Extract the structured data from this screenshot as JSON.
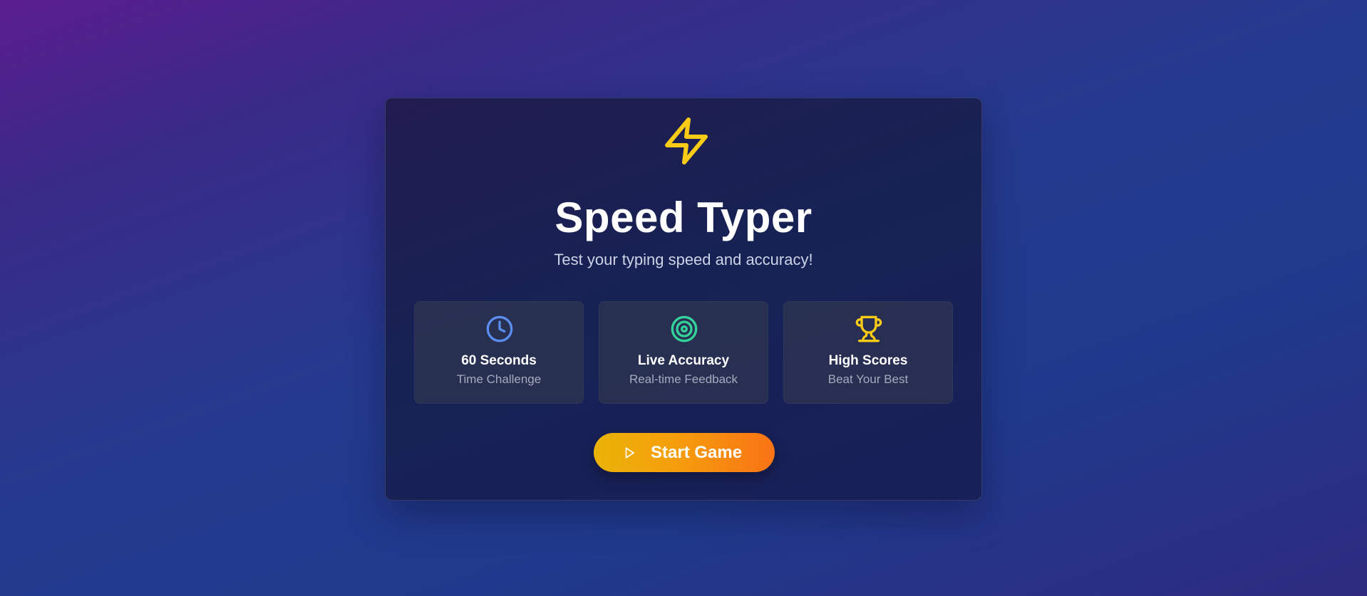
{
  "app": {
    "title": "Speed Typer",
    "subtitle": "Test your typing speed and accuracy!",
    "logo_icon": "lightning-bolt-icon"
  },
  "features": [
    {
      "icon": "clock-icon",
      "icon_color": "#5b8def",
      "title": "60 Seconds",
      "subtitle": "Time Challenge"
    },
    {
      "icon": "target-icon",
      "icon_color": "#34d399",
      "title": "Live Accuracy",
      "subtitle": "Real-time Feedback"
    },
    {
      "icon": "trophy-icon",
      "icon_color": "#facc15",
      "title": "High Scores",
      "subtitle": "Beat Your Best"
    }
  ],
  "start_button": {
    "label": "Start Game",
    "icon": "play-icon"
  },
  "colors": {
    "accent_yellow": "#facc15",
    "button_gradient_start": "#eab308",
    "button_gradient_end": "#f97316",
    "card_background": "#172254"
  }
}
